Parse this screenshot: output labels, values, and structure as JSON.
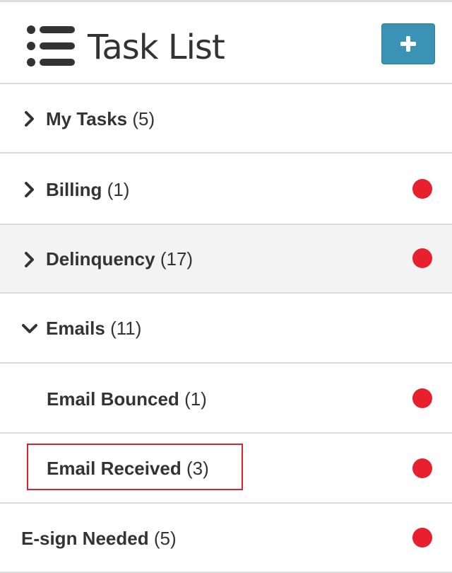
{
  "header": {
    "title": "Task List",
    "add_button_label": "+"
  },
  "colors": {
    "accent": "#3a93b4",
    "alert_dot": "#e8202e",
    "highlight_border": "#d9232f",
    "divider": "#dcdcdc"
  },
  "task_groups": [
    {
      "name": "My Tasks",
      "count": "(5)",
      "expander": "chevron-right",
      "alert": false,
      "selected": false
    },
    {
      "name": "Billing",
      "count": "(1)",
      "expander": "chevron-right",
      "alert": true,
      "selected": false
    },
    {
      "name": "Delinquency",
      "count": "(17)",
      "expander": "chevron-right",
      "alert": true,
      "selected": true
    },
    {
      "name": "Emails",
      "count": "(11)",
      "expander": "chevron-down",
      "alert": false,
      "selected": false
    },
    {
      "name": "Email Bounced",
      "count": "(1)",
      "expander": null,
      "alert": true,
      "selected": false
    },
    {
      "name": "Email Received",
      "count": "(3)",
      "expander": null,
      "alert": true,
      "selected": false,
      "highlighted": true
    },
    {
      "name": "E-sign Needed",
      "count": "(5)",
      "expander": null,
      "alert": true,
      "selected": false
    }
  ]
}
